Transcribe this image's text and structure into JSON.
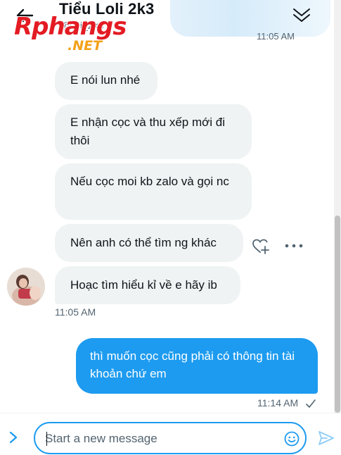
{
  "header": {
    "title": "Tiểu Loli 2k3",
    "subtitle": "@...i_2k3",
    "top_time": "11:05 AM"
  },
  "watermark": {
    "main": "Rphangs",
    "net": ".NET"
  },
  "messages": {
    "incoming": [
      "E nói lun nhé",
      "E nhận cọc và thu xếp mới đi thôi",
      "Nếu cọc moi kb zalo và gọi nc",
      "Nên anh có thể tìm ng khác",
      "Hoạc tìm hiểu kỉ về e hãy ib"
    ],
    "incoming_time": "11:05 AM",
    "outgoing": "thì muốn cọc cũng phải có thông tin tài khoản chứ em",
    "outgoing_time": "11:14 AM"
  },
  "composer": {
    "placeholder": "Start a new message"
  },
  "icons": {
    "back": "back-arrow-icon",
    "collapse": "double-chevron-down-icon",
    "react": "heart-plus-icon",
    "more": "more-horizontal-icon",
    "read": "checkmark-icon",
    "expand": "chevron-right-icon",
    "emoji": "emoji-icon",
    "send": "send-icon"
  },
  "colors": {
    "accent": "#1d9bf0",
    "incoming_bubble": "#eff3f4",
    "watermark_red": "#e31b23",
    "watermark_orange": "#f4a11a"
  }
}
